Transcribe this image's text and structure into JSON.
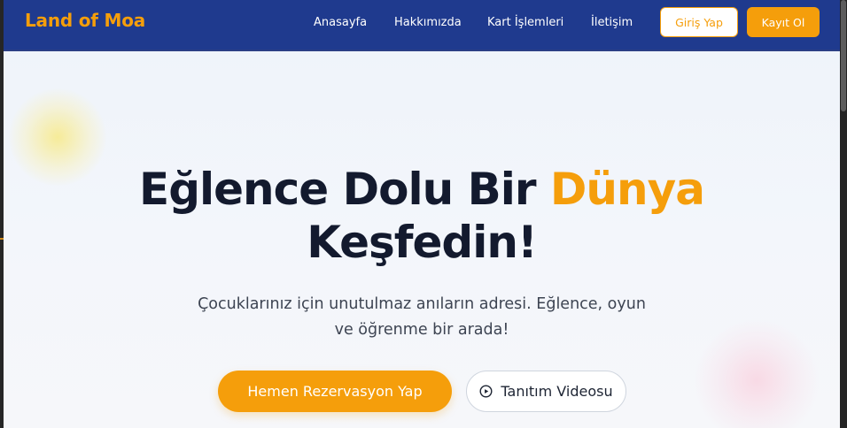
{
  "navbar": {
    "brand": "Land of Moa",
    "links": [
      {
        "label": "Anasayfa"
      },
      {
        "label": "Hakkımızda"
      },
      {
        "label": "Kart İşlemleri"
      },
      {
        "label": "İletişim"
      }
    ],
    "login_label": "Giriş Yap",
    "register_label": "Kayıt Ol"
  },
  "hero": {
    "title_part1": "Eğlence Dolu Bir ",
    "title_accent": "Dünya",
    "title_part2": "Keşfedin!",
    "subtitle": "Çocuklarınız için unutulmaz anıların adresi. Eğlence, oyun ve öğrenme bir arada!",
    "primary_button": "Hemen Rezervasyon Yap",
    "secondary_button": "Tanıtım Videosu"
  },
  "colors": {
    "navbar_bg": "#1f3a8e",
    "accent": "#f59e0b",
    "heading": "#131a2e",
    "body_text": "#3d4452"
  },
  "icons": {
    "video_button_icon": "play-circle-icon"
  }
}
